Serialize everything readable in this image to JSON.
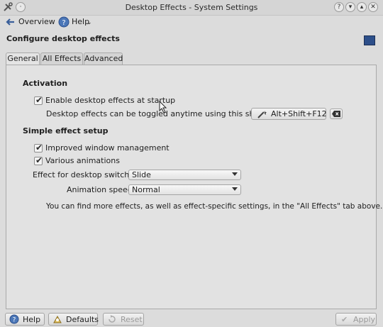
{
  "window": {
    "title": "Desktop Effects - System Settings"
  },
  "toolbar": {
    "overview_label": "Overview",
    "help_label": "Help"
  },
  "header": {
    "title": "Configure desktop effects"
  },
  "tabs": [
    {
      "label": "General"
    },
    {
      "label": "All Effects"
    },
    {
      "label": "Advanced"
    }
  ],
  "activation": {
    "heading": "Activation",
    "enable_label": "Enable desktop effects at startup",
    "enable_checked": true,
    "shortcut_hint": "Desktop effects can be toggled anytime using this shortcut:",
    "shortcut_value": "Alt+Shift+F12"
  },
  "simple": {
    "heading": "Simple effect setup",
    "improved_label": "Improved window management",
    "improved_checked": true,
    "various_label": "Various animations",
    "various_checked": true,
    "switch_label": "Effect for desktop switching:",
    "switch_value": "Slide",
    "speed_label": "Animation speed:",
    "speed_value": "Normal",
    "info_text": "You can find more effects, as well as effect-specific settings, in the \"All Effects\" tab above."
  },
  "buttons": {
    "help": "Help",
    "defaults": "Defaults",
    "reset": "Reset",
    "apply": "Apply"
  },
  "icons": {
    "app": "tools-icon",
    "title_buttons": [
      "help-icon",
      "minimize-icon",
      "maximize-icon",
      "close-icon"
    ]
  }
}
